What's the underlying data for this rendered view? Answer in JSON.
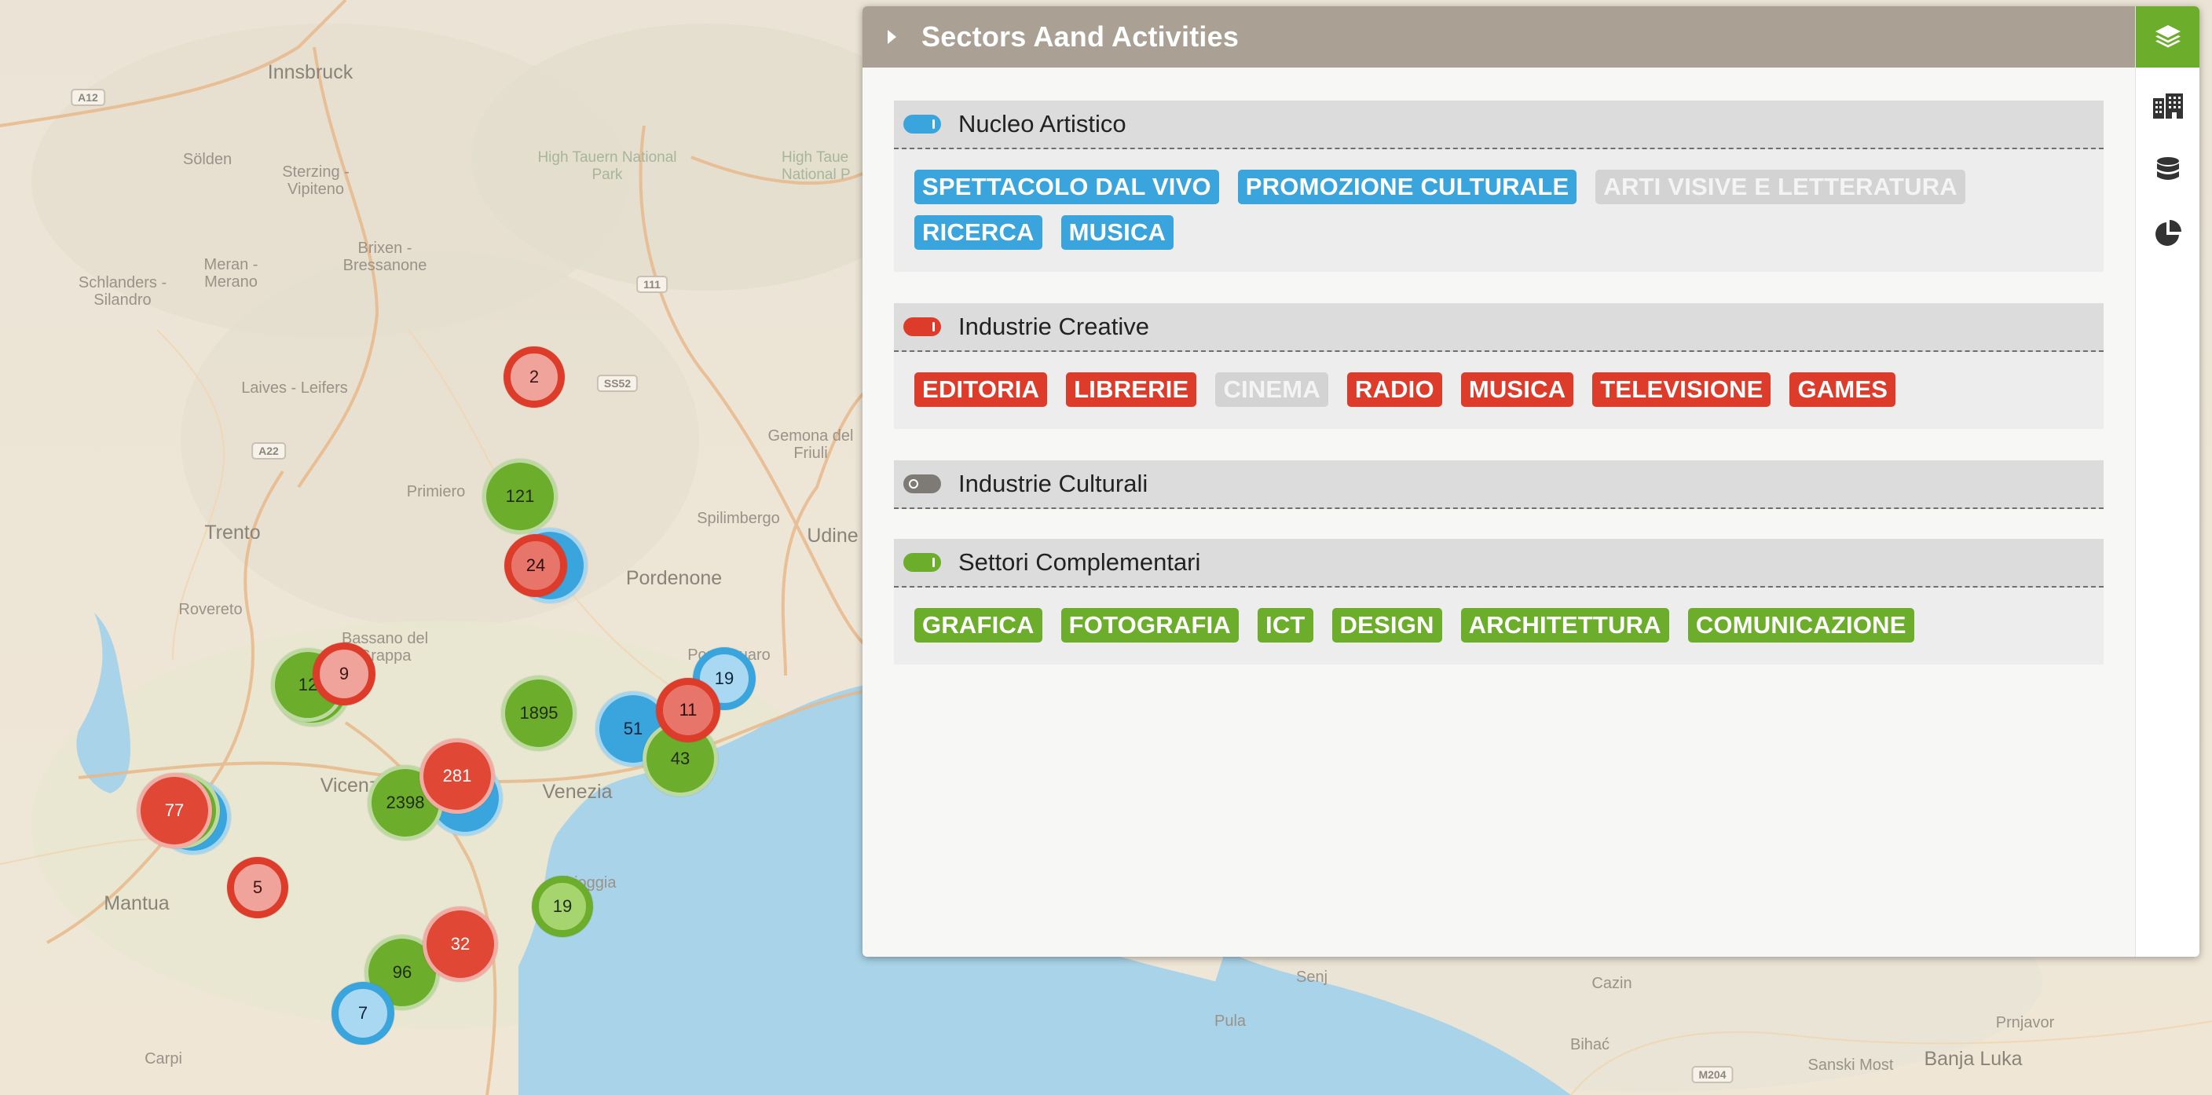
{
  "panel": {
    "title": "Sectors Aand Activities",
    "side_tabs": [
      {
        "icon": "layers-icon",
        "active": true
      },
      {
        "icon": "buildings-icon",
        "active": false
      },
      {
        "icon": "database-icon",
        "active": false
      },
      {
        "icon": "pie-chart-icon",
        "active": false
      }
    ],
    "sections": [
      {
        "name": "Nucleo Artistico",
        "toggle": "on",
        "color": "#3aa4dc",
        "tags": [
          {
            "label": "SPETTACOLO DAL VIVO",
            "enabled": true
          },
          {
            "label": "PROMOZIONE CULTURALE",
            "enabled": true
          },
          {
            "label": "ARTI VISIVE E LETTERATURA",
            "enabled": false
          },
          {
            "label": "RICERCA",
            "enabled": true
          },
          {
            "label": "MUSICA",
            "enabled": true
          }
        ]
      },
      {
        "name": "Industrie Creative",
        "toggle": "on",
        "color": "#dd3c2b",
        "tags": [
          {
            "label": "EDITORIA",
            "enabled": true
          },
          {
            "label": "LIBRERIE",
            "enabled": true
          },
          {
            "label": "CINEMA",
            "enabled": false
          },
          {
            "label": "RADIO",
            "enabled": true
          },
          {
            "label": "MUSICA",
            "enabled": true
          },
          {
            "label": "TELEVISIONE",
            "enabled": true
          },
          {
            "label": "GAMES",
            "enabled": true
          }
        ]
      },
      {
        "name": "Industrie Culturali",
        "toggle": "off",
        "color": "#7e7a75",
        "tags": []
      },
      {
        "name": "Settori Complementari",
        "toggle": "on",
        "color": "#6cad2b",
        "tags": [
          {
            "label": "GRAFICA",
            "enabled": true
          },
          {
            "label": "FOTOGRAFIA",
            "enabled": true
          },
          {
            "label": "ICT",
            "enabled": true
          },
          {
            "label": "DESIGN",
            "enabled": true
          },
          {
            "label": "ARCHITETTURA",
            "enabled": true
          },
          {
            "label": "COMUNICAZIONE",
            "enabled": true
          }
        ]
      }
    ]
  },
  "map": {
    "places": [
      {
        "name": "Innsbruck"
      },
      {
        "name": "Sölden"
      },
      {
        "name": "Sterzing - Vipiteno"
      },
      {
        "name": "High Tauern National Park"
      },
      {
        "name": "High Taue National P"
      },
      {
        "name": "Brixen - Bressanone"
      },
      {
        "name": "Meran - Merano"
      },
      {
        "name": "Schlanders - Silandro"
      },
      {
        "name": "Laives - Leifers"
      },
      {
        "name": "Primiero"
      },
      {
        "name": "Trento"
      },
      {
        "name": "Rovereto"
      },
      {
        "name": "Bassano del Grappa"
      },
      {
        "name": "Gemona del Friuli"
      },
      {
        "name": "Spilimbergo"
      },
      {
        "name": "Udine"
      },
      {
        "name": "Pordenone"
      },
      {
        "name": "Vicenza"
      },
      {
        "name": "Venezia"
      },
      {
        "name": "Mantua"
      },
      {
        "name": "Chioggia"
      },
      {
        "name": "Carpi"
      },
      {
        "name": "Senj"
      },
      {
        "name": "Pula"
      },
      {
        "name": "Cazin"
      },
      {
        "name": "Bihać"
      },
      {
        "name": "Sanski Most"
      },
      {
        "name": "Banja Luka"
      },
      {
        "name": "Prnjavor"
      },
      {
        "name": "Portogruaro"
      }
    ],
    "shields": [
      "A12",
      "111",
      "SS52",
      "A22",
      "M204"
    ],
    "clusters": [
      {
        "label": "2",
        "style": "lred"
      },
      {
        "label": "121",
        "style": "green"
      },
      {
        "label": "",
        "style": "blue"
      },
      {
        "label": "24",
        "style": "redr"
      },
      {
        "label": "",
        "style": "green"
      },
      {
        "label": "12",
        "style": "green"
      },
      {
        "label": "9",
        "style": "lred"
      },
      {
        "label": "1895",
        "style": "green"
      },
      {
        "label": "19",
        "style": "lblue"
      },
      {
        "label": "51",
        "style": "blue"
      },
      {
        "label": "43",
        "style": "green"
      },
      {
        "label": "11",
        "style": "redr"
      },
      {
        "label": "",
        "style": "blue"
      },
      {
        "label": "",
        "style": "green"
      },
      {
        "label": "77",
        "style": "red"
      },
      {
        "label": "",
        "style": "blue"
      },
      {
        "label": "2398",
        "style": "green"
      },
      {
        "label": "281",
        "style": "red"
      },
      {
        "label": "5",
        "style": "lred"
      },
      {
        "label": "19",
        "style": "lgreen"
      },
      {
        "label": "96",
        "style": "green"
      },
      {
        "label": "32",
        "style": "red"
      },
      {
        "label": "7",
        "style": "lblue"
      }
    ]
  }
}
